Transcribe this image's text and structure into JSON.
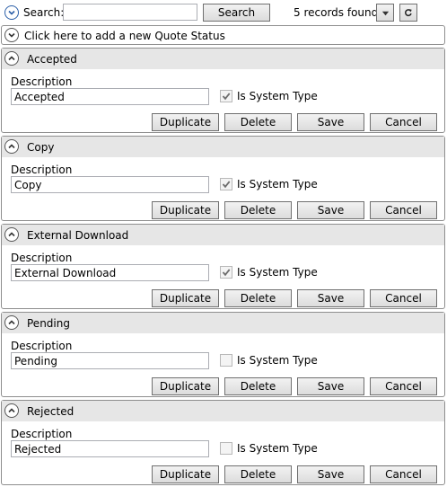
{
  "toolbar": {
    "search_label": "Search:",
    "search_value": "",
    "search_button": "Search",
    "records_text": "5 records found."
  },
  "add_bar": {
    "label": "Click here to add a new Quote Status"
  },
  "panel_labels": {
    "description": "Description",
    "system_type": "Is System Type",
    "duplicate": "Duplicate",
    "delete": "Delete",
    "save": "Save",
    "cancel": "Cancel"
  },
  "records": [
    {
      "title": "Accepted",
      "description": "Accepted",
      "is_system_type": true
    },
    {
      "title": "Copy",
      "description": "Copy",
      "is_system_type": true
    },
    {
      "title": "External Download",
      "description": "External Download",
      "is_system_type": true
    },
    {
      "title": "Pending",
      "description": "Pending",
      "is_system_type": false
    },
    {
      "title": "Rejected",
      "description": "Rejected",
      "is_system_type": false
    }
  ],
  "icons": {
    "collapse_toolbar": "chevron-down-circle-icon",
    "add_record": "chevron-down-circle-icon",
    "panel_toggle": "chevron-up-circle-icon",
    "dropdown": "dropdown-arrow-icon",
    "refresh": "refresh-icon",
    "check": "checkmark-icon"
  },
  "colors": {
    "panel_header": "#e6e6e6",
    "border": "#8e8e8e",
    "accent": "#2b5fa8"
  }
}
